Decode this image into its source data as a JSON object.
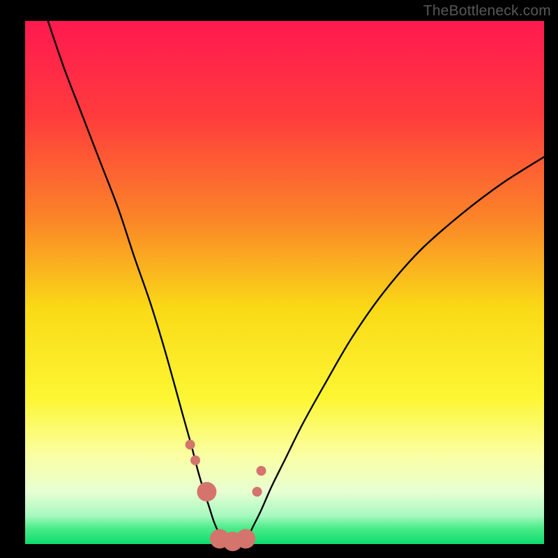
{
  "watermark": {
    "text": "TheBottleneck.com"
  },
  "chart_data": {
    "type": "line",
    "title": "",
    "xlabel": "",
    "ylabel": "",
    "xlim": [
      0,
      100
    ],
    "ylim": [
      0,
      100
    ],
    "grid": false,
    "legend": false,
    "background_gradient": {
      "stops": [
        {
          "offset": 0.0,
          "color": "#ff1950"
        },
        {
          "offset": 0.18,
          "color": "#ff3b3d"
        },
        {
          "offset": 0.38,
          "color": "#fb8528"
        },
        {
          "offset": 0.55,
          "color": "#fada17"
        },
        {
          "offset": 0.72,
          "color": "#fdf633"
        },
        {
          "offset": 0.83,
          "color": "#fbffa3"
        },
        {
          "offset": 0.9,
          "color": "#e7ffd2"
        },
        {
          "offset": 0.945,
          "color": "#a9f9c0"
        },
        {
          "offset": 0.97,
          "color": "#4aeb89"
        },
        {
          "offset": 1.0,
          "color": "#0cdc6f"
        }
      ]
    },
    "series": [
      {
        "name": "left-curve",
        "type": "line",
        "color": "#000000",
        "x": [
          4.4,
          7.5,
          11.0,
          14.5,
          18.0,
          21.0,
          24.0,
          26.5,
          28.5,
          30.3,
          32.0,
          33.3,
          34.5,
          35.5,
          36.3,
          37.0,
          37.5,
          38.0
        ],
        "values": [
          100,
          91.0,
          82.0,
          73.0,
          64.0,
          55.0,
          46.5,
          38.5,
          31.5,
          25.0,
          19.0,
          14.0,
          10.0,
          7.0,
          4.5,
          2.8,
          1.5,
          0.0
        ]
      },
      {
        "name": "right-curve",
        "type": "line",
        "color": "#000000",
        "x": [
          42.0,
          43.0,
          44.0,
          45.5,
          47.5,
          50.0,
          53.5,
          58.0,
          63.0,
          69.0,
          76.0,
          84.0,
          92.0,
          100.0
        ],
        "values": [
          0.0,
          1.5,
          3.5,
          6.5,
          11.0,
          16.0,
          23.0,
          31.0,
          39.5,
          48.0,
          56.0,
          63.0,
          69.0,
          74.0
        ]
      },
      {
        "name": "markers",
        "type": "scatter",
        "color": "#d4746c",
        "x": [
          31.8,
          32.8,
          35.0,
          37.5,
          40.0,
          42.5,
          44.7,
          45.5
        ],
        "values": [
          19.0,
          16.0,
          10.0,
          1.0,
          0.5,
          1.0,
          10.0,
          14.0
        ],
        "marker_size_px": [
          14,
          14,
          28,
          28,
          28,
          28,
          14,
          14
        ]
      }
    ]
  }
}
